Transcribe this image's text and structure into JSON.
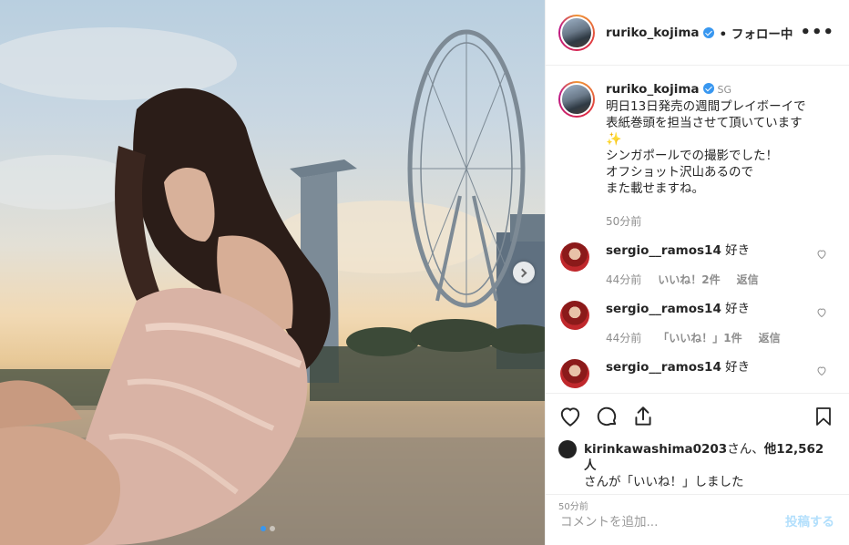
{
  "post": {
    "username": "ruriko_kojima",
    "follow_status": "• フォロー中",
    "more_label": "•••",
    "caption": {
      "username": "ruriko_kojima",
      "location_tag": "SG",
      "text": "明日13日発売の週間プレイボーイで\n表紙巻頭を担当させて頂いています",
      "sparkle": "✨",
      "text2": "シンガポールでの撮影でした！\nオフショット沢山あるので\nまた載せますね。",
      "time": "50分前"
    },
    "comments": [
      {
        "username": "sergio__ramos14",
        "text": "好き",
        "time": "44分前",
        "likes": "いいね！2件",
        "reply": "返信"
      },
      {
        "username": "sergio__ramos14",
        "text": "好き",
        "time": "44分前",
        "likes": "「いいね！」1件",
        "reply": "返信"
      },
      {
        "username": "sergio__ramos14",
        "text": "好き",
        "time": "",
        "likes": "",
        "reply": ""
      }
    ],
    "likes": {
      "user": "kirinkawashima0203",
      "suffix": "さん、",
      "others": "他12,562人",
      "line2": "さんが「いいね！」しました"
    },
    "post_time": "50分前",
    "add_comment": {
      "placeholder": "コメントを追加...",
      "post_label": "投稿する"
    },
    "carousel": {
      "current": 1,
      "total": 2
    }
  },
  "colors": {
    "accent": "#3897f0",
    "post_disabled": "#b2dffc",
    "muted": "#8e8e8e"
  },
  "icons": [
    "heart-icon",
    "comment-icon",
    "share-icon",
    "bookmark-icon",
    "chevron-right-icon",
    "verified-icon",
    "more-icon",
    "sparkle-icon"
  ]
}
